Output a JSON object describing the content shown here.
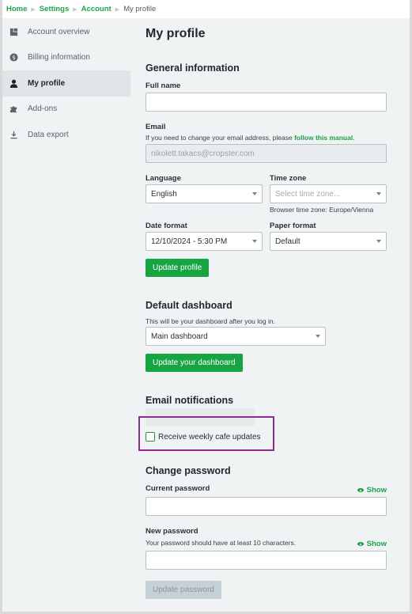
{
  "breadcrumb": {
    "items": [
      "Home",
      "Settings",
      "Account"
    ],
    "current": "My profile"
  },
  "sidebar": {
    "items": [
      {
        "label": "Account overview",
        "icon": "account-overview-icon",
        "active": false
      },
      {
        "label": "Billing information",
        "icon": "dollar-coin-icon",
        "active": false
      },
      {
        "label": "My profile",
        "icon": "user-icon",
        "active": true
      },
      {
        "label": "Add-ons",
        "icon": "puzzle-icon",
        "active": false
      },
      {
        "label": "Data export",
        "icon": "download-icon",
        "active": false
      }
    ]
  },
  "page": {
    "title": "My profile",
    "general": {
      "heading": "General information",
      "full_name_label": "Full name",
      "full_name_value": "",
      "email_label": "Email",
      "email_hint": "If you need to change your email address, please ",
      "email_hint_link": "follow this manual",
      "email_hint_end": ".",
      "email_value": "nikolett.takacs@cropster.com",
      "language_label": "Language",
      "language_value": "English",
      "timezone_label": "Time zone",
      "timezone_placeholder": "Select time zone...",
      "timezone_hint": "Browser time zone: Europe/Vienna",
      "date_format_label": "Date format",
      "date_format_value": "12/10/2024 - 5:30 PM",
      "paper_format_label": "Paper format",
      "paper_format_value": "Default",
      "update_button": "Update profile"
    },
    "dashboard": {
      "heading": "Default dashboard",
      "hint": "This will be your dashboard after you log in.",
      "value": "Main dashboard",
      "update_button": "Update your dashboard"
    },
    "notifications": {
      "heading": "Email notifications",
      "checkbox_label": "Receive weekly cafe updates",
      "checked": false
    },
    "password": {
      "heading": "Change password",
      "current_label": "Current password",
      "show_label": "Show",
      "new_label": "New password",
      "new_hint": "Your password should have at least 10 characters.",
      "update_button": "Update password"
    }
  },
  "colors": {
    "accent": "#1ca34a",
    "button": "#17a544",
    "highlight": "#8e2a92"
  }
}
